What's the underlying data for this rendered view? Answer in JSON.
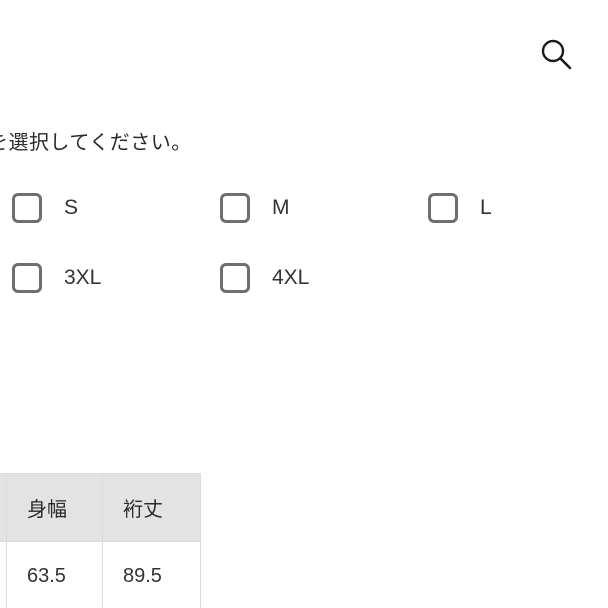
{
  "header": {
    "search_icon": "search-icon"
  },
  "size_selector": {
    "instruction": "を選択してください。",
    "options": [
      {
        "label": "S",
        "checked": false
      },
      {
        "label": "M",
        "checked": false
      },
      {
        "label": "L",
        "checked": false
      },
      {
        "label": "3XL",
        "checked": false
      },
      {
        "label": "4XL",
        "checked": false
      }
    ]
  },
  "size_table": {
    "headers": [
      "",
      "身幅",
      "裄丈"
    ],
    "rows": [
      [
        "",
        "63.5",
        "89.5"
      ]
    ]
  },
  "colors": {
    "checkbox_border": "#6f6f6f",
    "table_header_bg": "#e3e3e3",
    "table_border": "#dcdcdc"
  }
}
